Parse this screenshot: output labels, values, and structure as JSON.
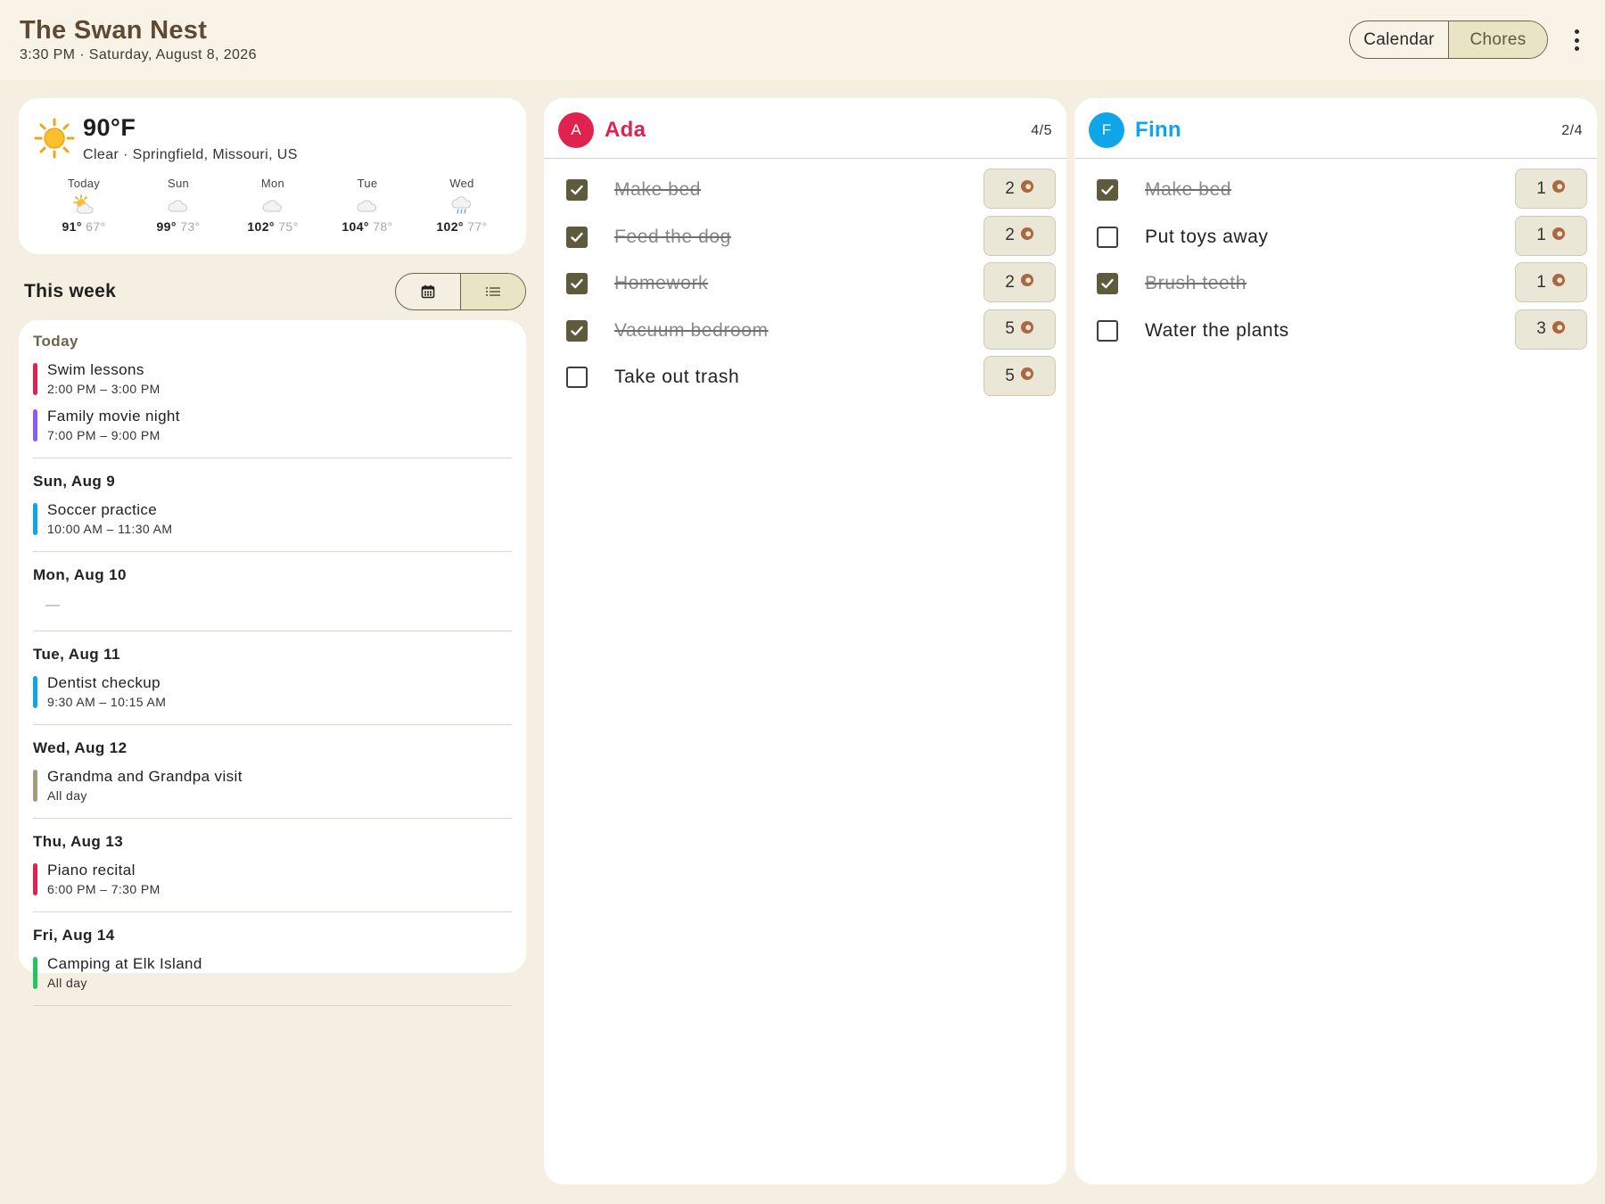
{
  "header": {
    "title": "The Swan Nest",
    "subtitle": "3:30 PM · Saturday, August 8, 2026",
    "views": [
      {
        "label": "Calendar",
        "active": false
      },
      {
        "label": "Chores",
        "active": true
      }
    ]
  },
  "weather": {
    "temp": "90°F",
    "condition": "Clear · Springfield, Missouri, US",
    "icon": "sun-icon",
    "forecast": [
      {
        "day": "Today",
        "icon": "partly-sunny-icon",
        "hi": "91°",
        "lo": "67°"
      },
      {
        "day": "Sun",
        "icon": "cloud-icon",
        "hi": "99°",
        "lo": "73°"
      },
      {
        "day": "Mon",
        "icon": "cloud-icon",
        "hi": "102°",
        "lo": "75°"
      },
      {
        "day": "Tue",
        "icon": "cloud-icon",
        "hi": "104°",
        "lo": "78°"
      },
      {
        "day": "Wed",
        "icon": "rain-cloud-icon",
        "hi": "102°",
        "lo": "77°"
      }
    ]
  },
  "week": {
    "title": "This week",
    "views": [
      {
        "icon": "calendar-icon",
        "active": false
      },
      {
        "icon": "list-icon",
        "active": true
      }
    ],
    "days": [
      {
        "label": "Today",
        "today": true,
        "events": [
          {
            "name": "Swim lessons",
            "time": "2:00 PM – 3:00 PM",
            "color": "#e0234e"
          },
          {
            "name": "Family movie night",
            "time": "7:00 PM – 9:00 PM",
            "color": "#8b5cf6"
          }
        ]
      },
      {
        "label": "Sun, Aug 9",
        "events": [
          {
            "name": "Soccer practice",
            "time": "10:00 AM – 11:30 AM",
            "color": "#0ea5e9"
          }
        ]
      },
      {
        "label": "Mon, Aug 10",
        "events": [],
        "empty_text": "—"
      },
      {
        "label": "Tue, Aug 11",
        "events": [
          {
            "name": "Dentist checkup",
            "time": "9:30 AM – 10:15 AM",
            "color": "#0ea5e9"
          }
        ]
      },
      {
        "label": "Wed, Aug 12",
        "events": [
          {
            "name": "Grandma and Grandpa visit",
            "time": "All day",
            "color": "#a39c80"
          }
        ]
      },
      {
        "label": "Thu, Aug 13",
        "events": [
          {
            "name": "Piano recital",
            "time": "6:00 PM – 7:30 PM",
            "color": "#e0234e"
          }
        ]
      },
      {
        "label": "Fri, Aug 14",
        "events": [
          {
            "name": "Camping at Elk Island",
            "time": "All day",
            "color": "#22c55e"
          }
        ]
      }
    ]
  },
  "members": [
    {
      "id": "ada",
      "initial": "A",
      "name": "Ada",
      "color": "#e0234e",
      "count": "4/5",
      "chores": [
        {
          "label": "Make bed",
          "done": true,
          "points": "2"
        },
        {
          "label": "Feed the dog",
          "done": true,
          "points": "2"
        },
        {
          "label": "Homework",
          "done": true,
          "points": "2"
        },
        {
          "label": "Vacuum bedroom",
          "done": true,
          "points": "5"
        },
        {
          "label": "Take out trash",
          "done": false,
          "points": "5"
        }
      ]
    },
    {
      "id": "finn",
      "initial": "F",
      "name": "Finn",
      "color": "#0ea5e9",
      "count": "2/4",
      "chores": [
        {
          "label": "Make bed",
          "done": true,
          "points": "1"
        },
        {
          "label": "Put toys away",
          "done": false,
          "points": "1"
        },
        {
          "label": "Brush teeth",
          "done": true,
          "points": "1"
        },
        {
          "label": "Water the plants",
          "done": false,
          "points": "3"
        }
      ]
    }
  ],
  "colors": {
    "accent": "#6b6548",
    "accent_fill": "#e8e4c4",
    "checkbox_checked": "#5e5a3c",
    "points_icon": "#a9683f",
    "background": "#f5efe1"
  }
}
